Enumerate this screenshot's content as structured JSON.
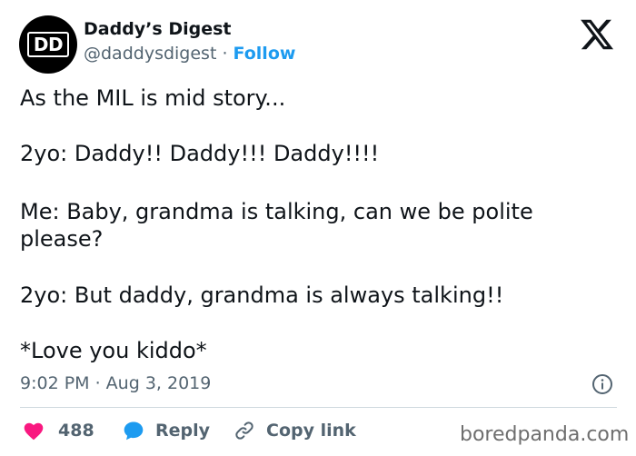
{
  "header": {
    "avatar_text": "DD",
    "display_name": "Daddy’s Digest",
    "handle": "@daddysdigest",
    "separator": " · ",
    "follow_label": "Follow"
  },
  "tweet": {
    "lines": [
      "As the MIL is mid story...",
      "2yo: Daddy!! Daddy!!! Daddy!!!!",
      "Me: Baby, grandma is talking, can we be polite please?",
      "2yo: But daddy, grandma is always talking!!",
      "*Love you kiddo*"
    ],
    "timestamp": "9:02 PM · Aug 3, 2019"
  },
  "actions": {
    "like_count": "488",
    "reply_label": "Reply",
    "copy_link_label": "Copy link"
  },
  "watermark": "boredpanda.com",
  "icons": {
    "brand": "x-logo-icon",
    "info": "info-icon",
    "like": "heart-icon",
    "reply": "speech-bubble-icon",
    "copy": "link-icon"
  },
  "colors": {
    "accent": "#1d9bf0",
    "like": "#f91880",
    "text_primary": "#0f1419",
    "text_secondary": "#536471",
    "divider": "#cfd9de"
  }
}
